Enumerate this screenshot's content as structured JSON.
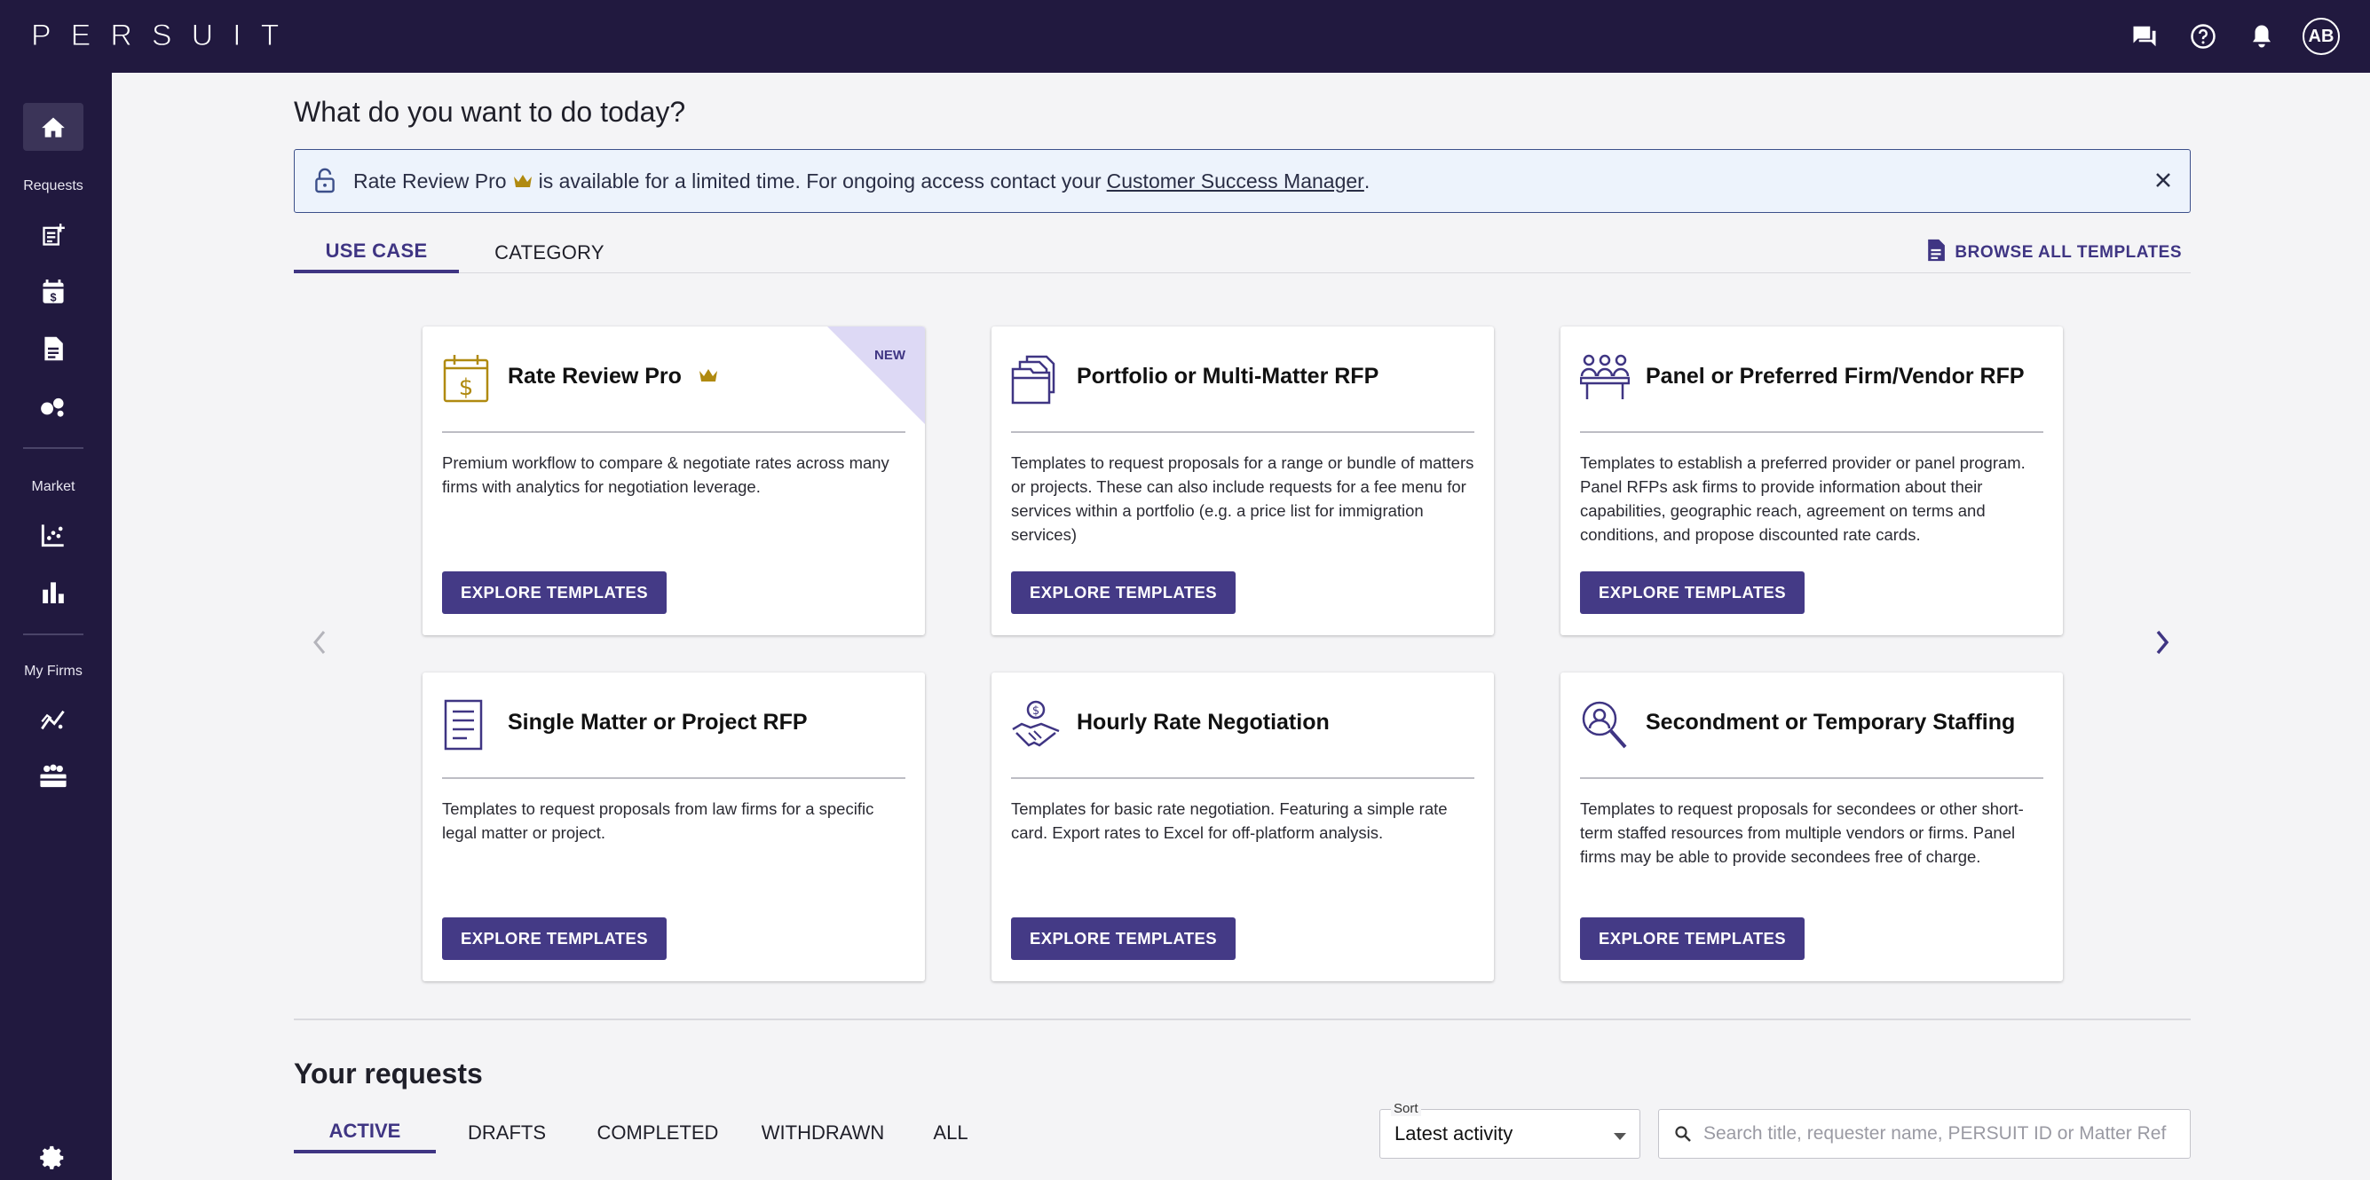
{
  "app": {
    "logo_text": "PERSUIT",
    "avatar_initials": "AB"
  },
  "top_icons": [
    "chat-icon",
    "help-icon",
    "bell-icon"
  ],
  "sidebar": {
    "sections": [
      {
        "label": "Requests"
      },
      {
        "label": "Market"
      },
      {
        "label": "My Firms"
      }
    ],
    "icons": [
      "home-icon",
      "new-request-icon",
      "rate-calendar-icon",
      "document-icon",
      "bubbles-icon",
      "market-scatter-icon",
      "market-bar-icon",
      "firm-analytics-icon",
      "firms-group-icon",
      "settings-icon"
    ]
  },
  "main": {
    "heading": "What do you want to do today?",
    "banner": {
      "product": "Rate Review Pro",
      "message": "is available for a limited time. For ongoing access contact your",
      "link_text": "Customer Success Manager",
      "trailing": "."
    },
    "tabs": [
      {
        "label": "USE CASE"
      },
      {
        "label": "CATEGORY"
      }
    ],
    "browse_label": "BROWSE ALL TEMPLATES",
    "cards": [
      {
        "title": "Rate Review Pro",
        "badge": "NEW",
        "desc": "Premium workflow to compare & negotiate rates across many firms with analytics for negotiation leverage.",
        "button": "EXPLORE TEMPLATES",
        "icon": "dollar-calendar-icon"
      },
      {
        "title": "Portfolio or Multi-Matter RFP",
        "desc": "Templates to request proposals for a range or bundle of matters or projects. These can also include requests for a fee menu for services within a portfolio (e.g. a price list for immigration services)",
        "button": "EXPLORE TEMPLATES",
        "icon": "portfolio-folders-icon"
      },
      {
        "title": "Panel or Preferred Firm/Vendor RFP",
        "desc": "Templates to establish a preferred provider or panel program. Panel RFPs ask firms to provide information about their capabilities, geographic reach, agreement on terms and conditions, and propose discounted rate cards.",
        "button": "EXPLORE TEMPLATES",
        "icon": "panel-people-icon"
      },
      {
        "title": "Single Matter or Project RFP",
        "desc": "Templates to request proposals from law firms for a specific legal matter or project.",
        "button": "EXPLORE TEMPLATES",
        "icon": "single-document-icon"
      },
      {
        "title": "Hourly Rate Negotiation",
        "desc": "Templates for basic rate negotiation. Featuring a simple rate card. Export rates to Excel for off-platform analysis.",
        "button": "EXPLORE TEMPLATES",
        "icon": "handshake-icon"
      },
      {
        "title": "Secondment or Temporary Staffing",
        "desc": "Templates to request proposals for secondees or other short-term staffed resources from multiple vendors or firms. Panel firms may be able to provide secondees free of charge.",
        "button": "EXPLORE TEMPLATES",
        "icon": "person-search-icon"
      }
    ]
  },
  "requests": {
    "heading": "Your requests",
    "tabs": [
      {
        "label": "ACTIVE"
      },
      {
        "label": "DRAFTS"
      },
      {
        "label": "COMPLETED"
      },
      {
        "label": "WITHDRAWN"
      },
      {
        "label": "ALL"
      }
    ],
    "sort_label": "Sort",
    "sort_value": "Latest activity",
    "search_placeholder": "Search title, requester name, PERSUIT ID or Matter Ref"
  },
  "colors": {
    "brand_dark": "#21193f",
    "accent": "#3f3583",
    "button": "#443a86",
    "crown": "#b08a10",
    "banner_bg": "#edf3fc"
  }
}
